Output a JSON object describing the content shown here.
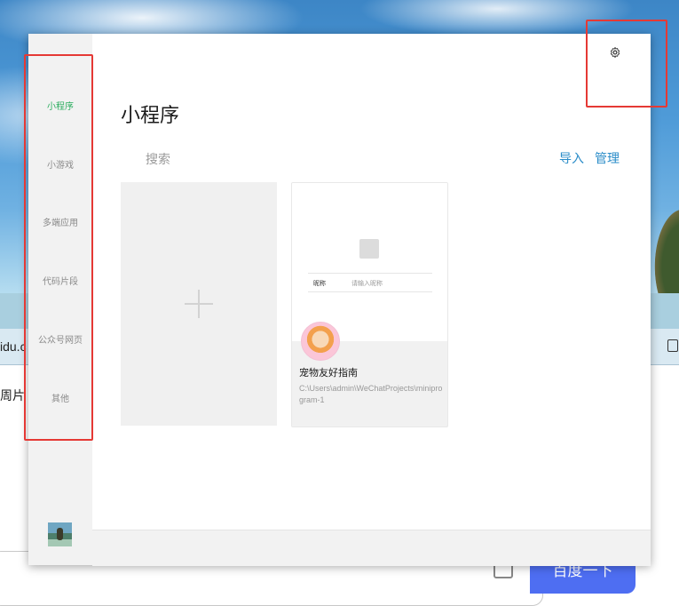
{
  "background": {
    "address_text": "idu.c",
    "side_text": "周片",
    "baidu_button": "百度一下"
  },
  "sidebar": {
    "items": [
      {
        "label": "小程序",
        "active": true
      },
      {
        "label": "小游戏",
        "active": false
      },
      {
        "label": "多端应用",
        "active": false
      },
      {
        "label": "代码片段",
        "active": false
      },
      {
        "label": "公众号网页",
        "active": false
      },
      {
        "label": "其他",
        "active": false
      }
    ]
  },
  "main": {
    "title": "小程序",
    "search_placeholder": "搜索",
    "import_label": "导入",
    "manage_label": "管理"
  },
  "project": {
    "name": "宠物友好指南",
    "path": "C:\\Users\\admin\\WeChatProjects\\miniprogram-1",
    "preview_field_label": "昵称",
    "preview_field_placeholder": "请输入昵称"
  },
  "colors": {
    "active_nav": "#2bad5e",
    "link": "#2a8cc8",
    "highlight_box": "#e53935"
  }
}
